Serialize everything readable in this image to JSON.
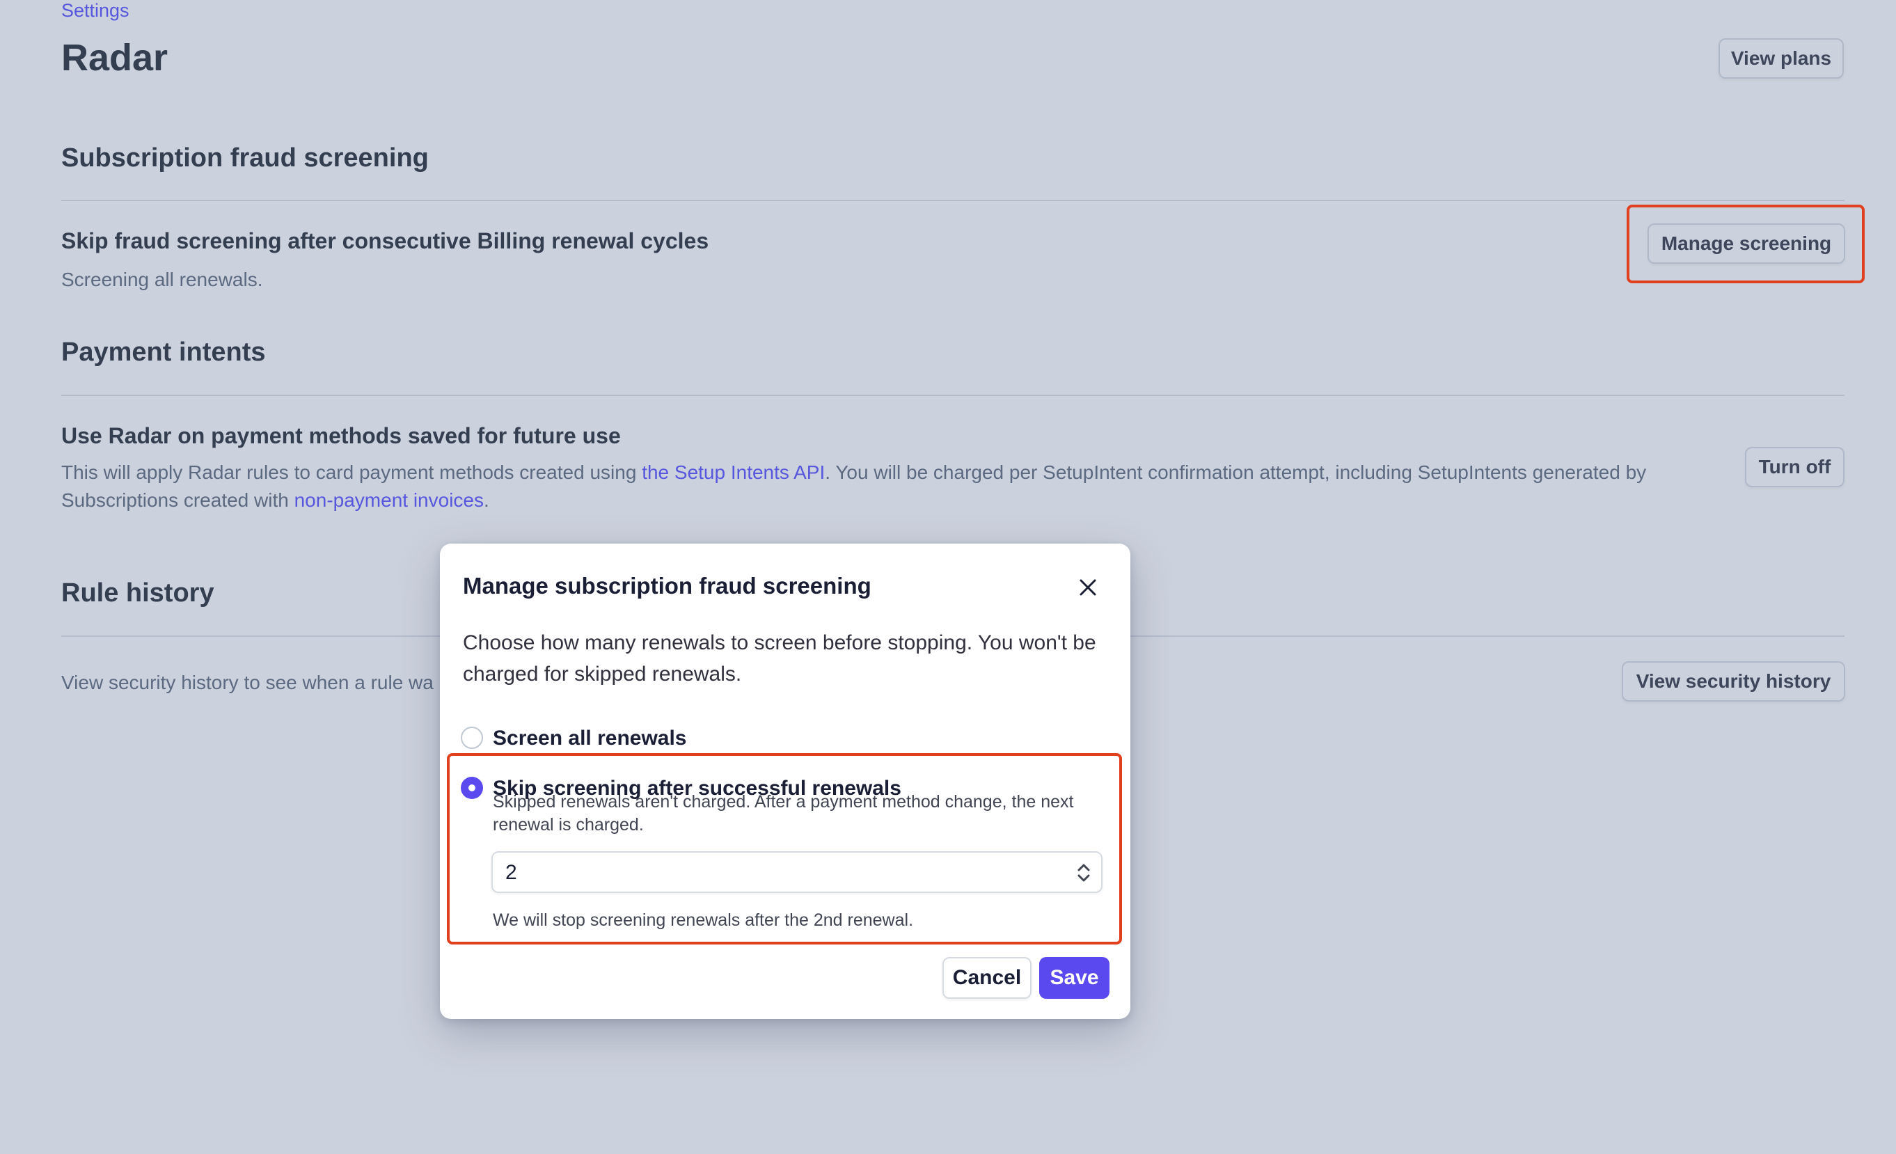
{
  "breadcrumb": "Settings",
  "page_title": "Radar",
  "header_button": "View plans",
  "sections": {
    "subscription": {
      "title": "Subscription fraud screening",
      "setting_title": "Skip fraud screening after consecutive Billing renewal cycles",
      "setting_desc": "Screening all renewals.",
      "button": "Manage screening"
    },
    "payment_intents": {
      "title": "Payment intents",
      "setting_title": "Use Radar on payment methods saved for future use",
      "desc_part1": "This will apply Radar rules to card payment methods created using ",
      "desc_link1": "the Setup Intents API",
      "desc_part2": ". You will be charged per SetupIntent confirmation attempt, including SetupIntents generated by Subscriptions created with ",
      "desc_link2": "non-payment invoices",
      "desc_part3": ".",
      "button": "Turn off"
    },
    "rule_history": {
      "title": "Rule history",
      "desc": "View security history to see when a rule wa",
      "button": "View security history"
    }
  },
  "modal": {
    "title": "Manage subscription fraud screening",
    "close_icon": "close-icon",
    "description": "Choose how many renewals to screen before stopping. You won't be charged for skipped renewals.",
    "options": [
      {
        "label": "Screen all renewals",
        "selected": false
      },
      {
        "label": "Skip screening after successful renewals",
        "selected": true,
        "help": "Skipped renewals aren't charged. After a payment method change, the next renewal is charged."
      }
    ],
    "select_value": "2",
    "select_note": "We will stop screening renewals after the 2nd renewal.",
    "cancel": "Cancel",
    "save": "Save"
  },
  "colors": {
    "accent": "#5b49f0",
    "link": "#635bff",
    "highlight": "#e0401e",
    "overlay": "rgba(52,74,120,0.25)"
  }
}
